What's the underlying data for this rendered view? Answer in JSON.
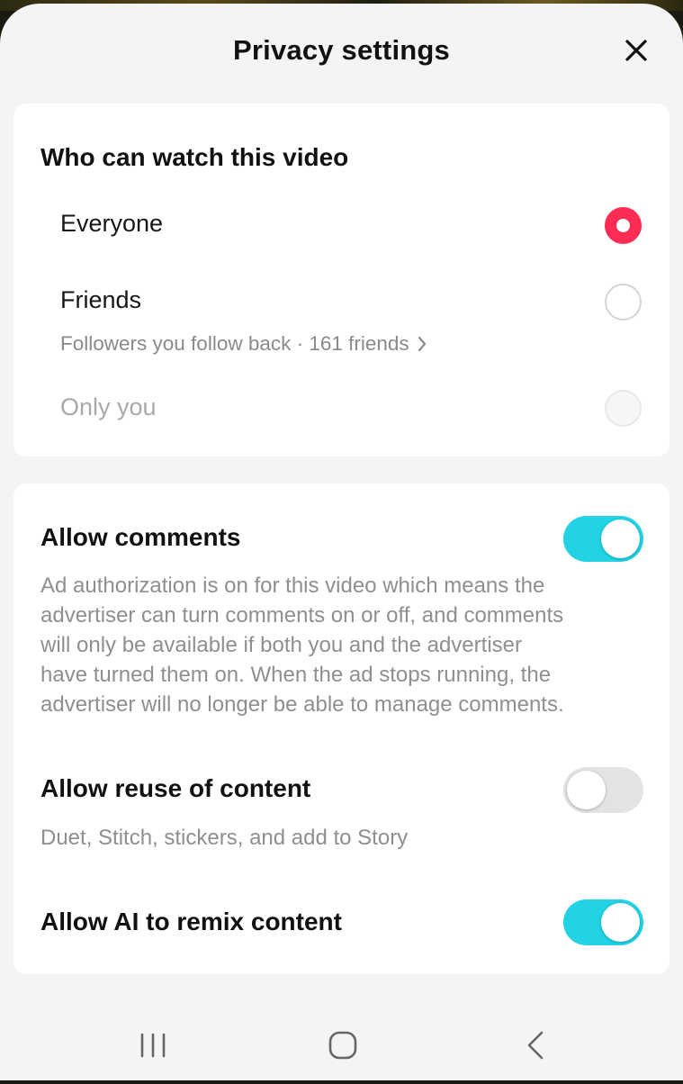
{
  "header": {
    "title": "Privacy settings",
    "close_icon": "close-icon"
  },
  "who_can_watch": {
    "title": "Who can watch this video",
    "options": [
      {
        "label": "Everyone",
        "selected": true,
        "enabled": true
      },
      {
        "label": "Friends",
        "sublabel": "Followers you follow back · 161 friends",
        "selected": false,
        "enabled": true
      },
      {
        "label": "Only you",
        "selected": false,
        "enabled": false
      }
    ]
  },
  "toggles": [
    {
      "title": "Allow comments",
      "on": true,
      "description_lines": [
        "Ad authorization is on for this video which means the",
        "advertiser can turn comments on or off, and comments",
        "will only be available if both you and the advertiser",
        "have turned them on. When the ad stops running, the",
        "advertiser will no longer be able to manage comments."
      ]
    },
    {
      "title": "Allow reuse of content",
      "on": false,
      "description": "Duet, Stitch, stickers, and add to Story"
    },
    {
      "title": "Allow AI to remix content",
      "on": true
    }
  ],
  "colors": {
    "accent": "#fe2c55",
    "toggle_on": "#22d3e6",
    "toggle_off": "#e3e3e3",
    "sheet_bg": "#f4f4f4"
  },
  "navbar": {
    "icons": [
      "recent-apps-icon",
      "home-icon",
      "back-icon"
    ]
  }
}
